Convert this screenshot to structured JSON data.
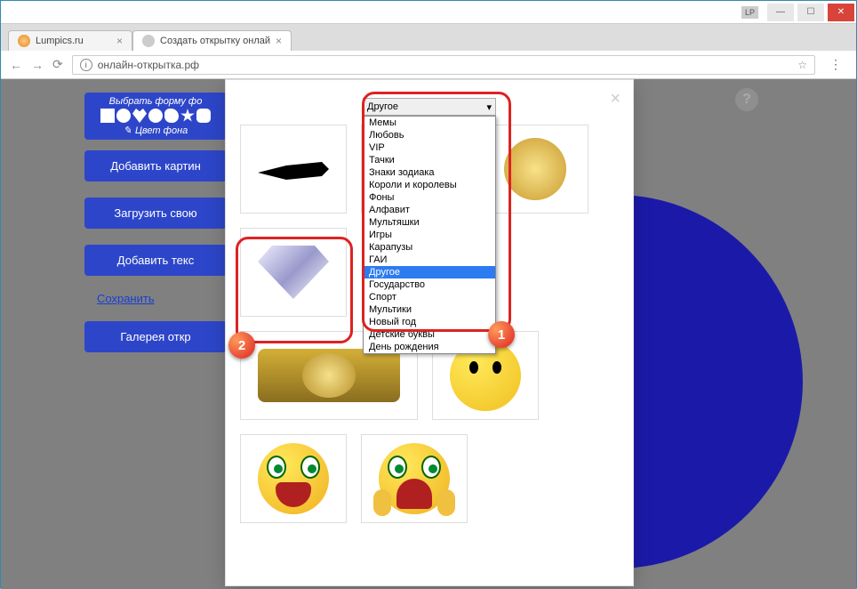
{
  "window": {
    "user_badge": "LP"
  },
  "tabs": [
    {
      "title": "Lumpics.ru"
    },
    {
      "title": "Создать открытку онлай"
    }
  ],
  "url": "онлайн-открытка.рф",
  "sidebar": {
    "shape_title": "Выбрать форму фо",
    "color_label": "Цвет фона",
    "btn_add_image": "Добавить картин",
    "btn_upload": "Загрузить свою",
    "btn_add_text": "Добавить текс",
    "link_save": "Сохранить",
    "btn_gallery": "Галерея откр"
  },
  "modal": {
    "selected": "Другое",
    "options": [
      "Мемы",
      "Любовь",
      "VIP",
      "Тачки",
      "Знаки зодиака",
      "Короли и королевы",
      "Фоны",
      "Алфавит",
      "Мультяшки",
      "Игры",
      "Карапузы",
      "ГАИ",
      "Другое",
      "Государство",
      "Спорт",
      "Мультики",
      "Новый год",
      "Детские буквы",
      "День рождения"
    ]
  },
  "annotations": {
    "badge1": "1",
    "badge2": "2"
  },
  "help": "?"
}
